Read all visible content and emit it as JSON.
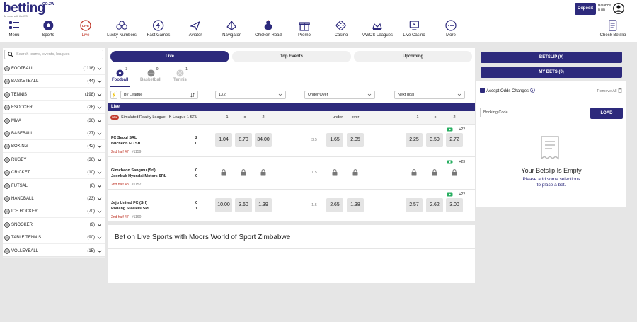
{
  "header": {
    "logo_text": "betting",
    "logo_sup": "CO.ZW",
    "logo_tag": "Be smart with the WS",
    "deposit_label": "Deposit",
    "balance_label": "Balance",
    "balance_value": "0.00"
  },
  "nav": [
    {
      "label": "Menu",
      "icon": "menu-icon"
    },
    {
      "label": "Sports",
      "icon": "soccer-ball-icon"
    },
    {
      "label": "Live",
      "icon": "live-icon"
    },
    {
      "label": "Lucky Numbers",
      "icon": "lottery-balls-icon"
    },
    {
      "label": "Fast Games",
      "icon": "fast-games-icon"
    },
    {
      "label": "Aviator",
      "icon": "airplane-icon"
    },
    {
      "label": "Navigator",
      "icon": "navigator-icon"
    },
    {
      "label": "Chicken Road",
      "icon": "chicken-icon"
    },
    {
      "label": "Promo",
      "icon": "gift-icon"
    },
    {
      "label": "Casino",
      "icon": "dice-icon"
    },
    {
      "label": "MWOS Leagues",
      "icon": "league-icon"
    },
    {
      "label": "Live Casino",
      "icon": "live-casino-icon"
    },
    {
      "label": "More",
      "icon": "more-icon"
    },
    {
      "label": "Check Betslip",
      "icon": "check-betslip-icon"
    }
  ],
  "sidebar": {
    "search_placeholder": "Search teams, events, leagues",
    "sports": [
      {
        "name": "FOOTBALL",
        "count": "(1118)"
      },
      {
        "name": "BASKETBALL",
        "count": "(44)"
      },
      {
        "name": "TENNIS",
        "count": "(198)"
      },
      {
        "name": "ESOCCER",
        "count": "(28)"
      },
      {
        "name": "MMA",
        "count": "(36)"
      },
      {
        "name": "BASEBALL",
        "count": "(27)"
      },
      {
        "name": "BOXING",
        "count": "(42)"
      },
      {
        "name": "RUGBY",
        "count": "(36)"
      },
      {
        "name": "CRICKET",
        "count": "(10)"
      },
      {
        "name": "FUTSAL",
        "count": "(6)"
      },
      {
        "name": "HANDBALL",
        "count": "(23)"
      },
      {
        "name": "ICE HOCKEY",
        "count": "(70)"
      },
      {
        "name": "SNOOKER",
        "count": "(9)"
      },
      {
        "name": "TABLE TENNIS",
        "count": "(90)"
      },
      {
        "name": "VOLLEYBALL",
        "count": "(15)"
      }
    ]
  },
  "main": {
    "tabs": {
      "live": "Live",
      "top": "Top Events",
      "upcoming": "Upcoming"
    },
    "sport_tabs": [
      {
        "label": "Football",
        "count": "3"
      },
      {
        "label": "Basketball",
        "count": "0"
      },
      {
        "label": "Tennis",
        "count": "1"
      }
    ],
    "filters": {
      "league": "By League",
      "market1": "1X2",
      "market2": "Under/Over",
      "market3": "Next goal"
    },
    "live_label": "Live",
    "league": {
      "badge": "SRL",
      "name": "Simulated Reality League - K-League 1 SRL",
      "h1": "1",
      "hx": "x",
      "h2": "2",
      "hunder": "under",
      "hover": "over",
      "h3": "1",
      "h4": "x",
      "h5": "2"
    },
    "events": [
      {
        "home": "FC Seoul SRL",
        "away": "Bucheon FC Srl",
        "home_score": "2",
        "away_score": "0",
        "time": "2nd half 47",
        "id": "| #1159",
        "odds_1x2": [
          "1.04",
          "8.70",
          "34.00"
        ],
        "line": "3.5",
        "odds_uo": [
          "1.65",
          "2.05"
        ],
        "odds_ng": [
          "2.25",
          "3.50",
          "2.72"
        ],
        "more": "+22"
      },
      {
        "home": "Gimcheon Sangmu (Srl)",
        "away": "Jeonbuk Hyundai Motors SRL",
        "home_score": "0",
        "away_score": "0",
        "time": "2nd half 48",
        "id": "| #1152",
        "line": "1.5",
        "more": "+23"
      },
      {
        "home": "Jeju United FC (Srl)",
        "away": "Pohang Steelers SRL",
        "home_score": "0",
        "away_score": "1",
        "time": "2nd half 47",
        "id": "| #1160",
        "odds_1x2": [
          "10.00",
          "3.60",
          "1.39"
        ],
        "line": "1.5",
        "odds_uo": [
          "2.65",
          "1.38"
        ],
        "odds_ng": [
          "2.57",
          "2.62",
          "3.00"
        ],
        "more": "+22"
      }
    ]
  },
  "seo": {
    "title": "Bet on Live Sports with Moors World of Sport Zimbabwe"
  },
  "betslip": {
    "betslip_label": "BETSLIP (0)",
    "mybets_label": "MY BETS (0)",
    "accept_label": "Accept Odds Changes",
    "remove_all": "Remove All",
    "booking_placeholder": "Booking Code",
    "load_label": "LOAD",
    "empty_title": "Your Betslip Is Empty",
    "empty_line1": "Please add some selections",
    "empty_line2": "to place a bet."
  },
  "colors": {
    "brand": "#2d2a7c",
    "live": "#c0392b",
    "odds_bg": "#e4e4e4"
  }
}
